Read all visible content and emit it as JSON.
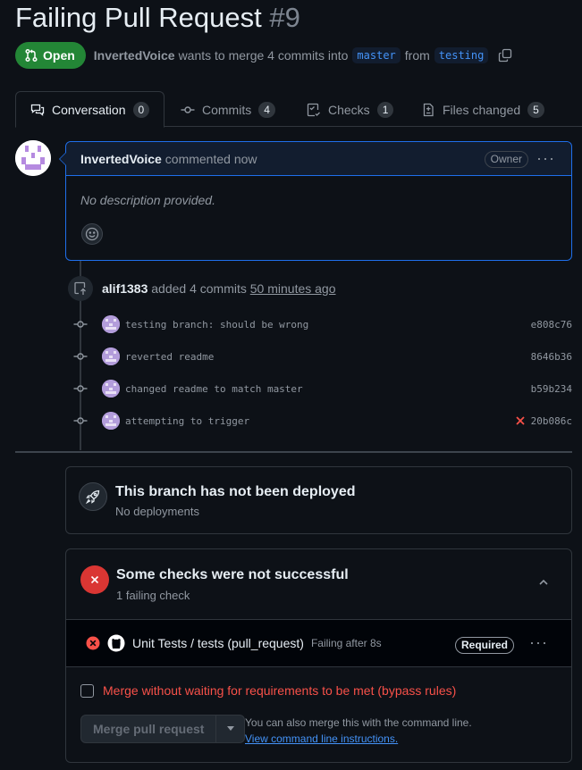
{
  "pr": {
    "title": "Failing Pull Request",
    "number": "#9",
    "state": "Open",
    "author": "InvertedVoice",
    "action_text": "wants to merge 4 commits into",
    "base_branch": "master",
    "from_text": "from",
    "head_branch": "testing"
  },
  "tabs": [
    {
      "label": "Conversation",
      "count": "0",
      "icon": "comment-discussion-icon"
    },
    {
      "label": "Commits",
      "count": "4",
      "icon": "git-commit-icon"
    },
    {
      "label": "Checks",
      "count": "1",
      "icon": "checklist-icon"
    },
    {
      "label": "Files changed",
      "count": "5",
      "icon": "file-diff-icon"
    }
  ],
  "comment": {
    "author": "InvertedVoice",
    "time": "commented now",
    "role": "Owner",
    "body": "No description provided."
  },
  "push": {
    "author": "alif1383",
    "text": "added 4 commits",
    "time": "50 minutes ago"
  },
  "commits": [
    {
      "message": "testing branch: should be wrong",
      "sha": "e808c76",
      "failed": false
    },
    {
      "message": "reverted readme",
      "sha": "8646b36",
      "failed": false
    },
    {
      "message": "changed readme to match master",
      "sha": "b59b234",
      "failed": false
    },
    {
      "message": "attempting to trigger",
      "sha": "20b086c",
      "failed": true
    }
  ],
  "deployment": {
    "title": "This branch has not been deployed",
    "subtitle": "No deployments"
  },
  "checks": {
    "title": "Some checks were not successful",
    "subtitle": "1 failing check",
    "items": [
      {
        "name": "Unit Tests / tests (pull_request)",
        "status": "Failing after 8s",
        "badge": "Required"
      }
    ]
  },
  "merge": {
    "bypass_label": "Merge without waiting for requirements to be met (bypass rules)",
    "button_label": "Merge pull request",
    "cli_text": "You can also merge this with the command line.",
    "cli_link": "View command line instructions."
  },
  "colors": {
    "open_green": "#238636",
    "danger": "#da3633",
    "accent_blue": "#4493f8",
    "background": "#0d1117"
  }
}
